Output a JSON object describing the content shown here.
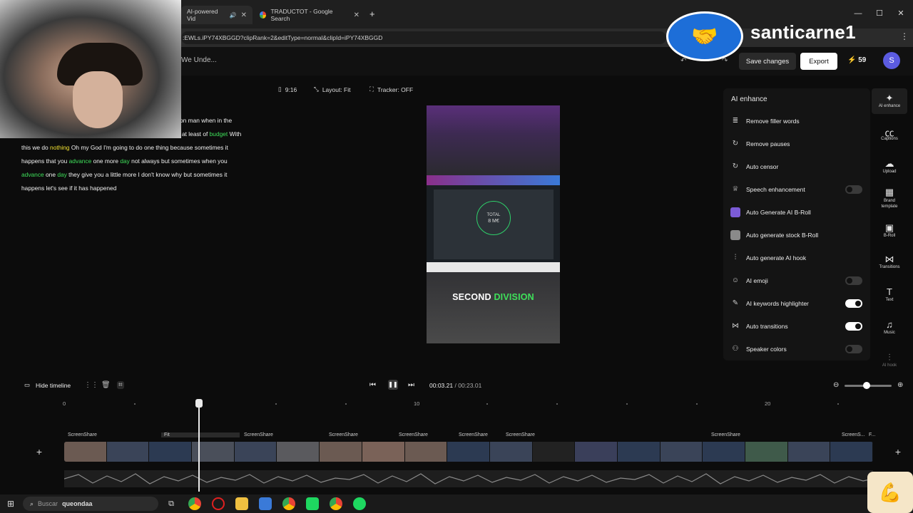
{
  "browser": {
    "tabs": [
      {
        "label": "AI-powered Vid"
      },
      {
        "label": "TRADUCTOT - Google Search"
      }
    ],
    "url": ":EWLs.iPY74XBGGD?clipRank=2&editType=normal&clipId=iPY74XBGGD"
  },
  "overlay": {
    "brand_name": "santicarne1"
  },
  "header": {
    "project_title": "We Unde...",
    "save_label": "Save changes",
    "export_label": "Export",
    "credits": "59",
    "avatar_letter": "S"
  },
  "transcript": {
    "line1_prefix": "on man when in the",
    "line2_a": "at least of ",
    "line2_kw": "budget",
    "line2_b": " With",
    "line3_a": "this we do ",
    "line3_kw": "nothing",
    "line3_b": " Oh my God I'm going to do one thing because sometimes it",
    "line4_a": "happens that you ",
    "line4_kw1": "advance",
    "line4_b": " one more ",
    "line4_kw2": "day",
    "line4_c": " not always but sometimes when you",
    "line5_kw1": "advance",
    "line5_b": " one ",
    "line5_kw2": "day",
    "line5_c": " they give you a little more I don't know why but sometimes it",
    "line6": "happens let's see if it has happened"
  },
  "preview_toolbar": {
    "aspect": "9:16",
    "layout": "Layout: Fit",
    "tracker": "Tracker: OFF"
  },
  "preview": {
    "caption_white": "SECOND",
    "caption_green": "DIVISION",
    "circle_label": "TOTAL",
    "circle_value": "8 M€"
  },
  "ai_panel": {
    "title": "AI enhance",
    "items": [
      {
        "label": "Remove filler words"
      },
      {
        "label": "Remove pauses"
      },
      {
        "label": "Auto censor"
      },
      {
        "label": "Speech enhancement",
        "toggle": "off"
      },
      {
        "label": "Auto Generate AI B-Roll"
      },
      {
        "label": "Auto generate stock B-Roll"
      },
      {
        "label": "Auto generate AI hook"
      },
      {
        "label": "AI emoji",
        "toggle": "off"
      },
      {
        "label": "AI keywords highlighter",
        "toggle": "on"
      },
      {
        "label": "Auto transitions",
        "toggle": "on"
      },
      {
        "label": "Speaker colors",
        "toggle": "off"
      }
    ]
  },
  "rail": [
    {
      "label": "AI enhance",
      "icon": "sparkle-icon"
    },
    {
      "label": "Captions",
      "icon": "captions-icon"
    },
    {
      "label": "Upload",
      "icon": "upload-icon"
    },
    {
      "label": "Brand template",
      "icon": "brand-icon"
    },
    {
      "label": "B-Roll",
      "icon": "broll-icon"
    },
    {
      "label": "Transitions",
      "icon": "transitions-icon"
    },
    {
      "label": "Text",
      "icon": "text-icon"
    },
    {
      "label": "Music",
      "icon": "music-icon"
    },
    {
      "label": "AI hook",
      "icon": "hook-icon"
    }
  ],
  "timeline": {
    "hide_label": "Hide timeline",
    "current_time": "00:03.21",
    "separator": "/",
    "total_time": "00:23.01",
    "ruler": [
      "0",
      "10",
      "20"
    ],
    "clip_labels": [
      "ScreenShare",
      "Fit",
      "ScreenShare",
      "ScreenShare",
      "ScreenShare",
      "ScreenShare",
      "ScreenShare",
      "ScreenShare",
      "ScreenS...",
      "F..."
    ]
  },
  "taskbar": {
    "search_placeholder": "Buscar",
    "search_text": "queondaa"
  },
  "colors": {
    "keyword_green": "#3ee05a",
    "keyword_yellow": "#f0e030",
    "accent_purple": "#5b5be0"
  }
}
